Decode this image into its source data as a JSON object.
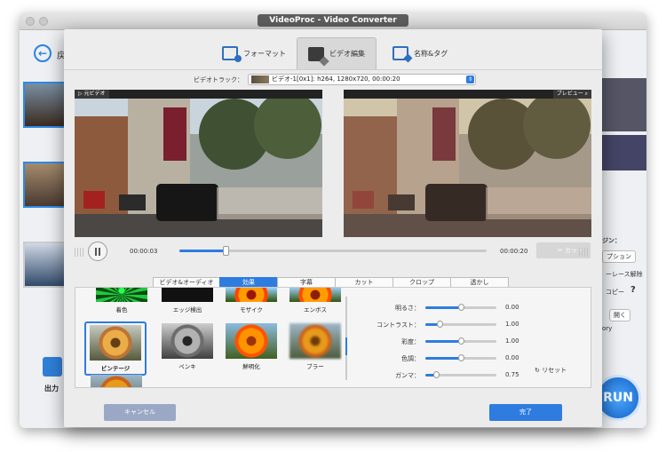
{
  "app": {
    "title": "VideoProc - Video Converter",
    "back_label": "戻",
    "output_label": "出力",
    "run_label": "RUN",
    "right_panel": {
      "heading": "ジン：",
      "option_button": "プション",
      "option_text": "ーレース解除",
      "copy_text": "コピー",
      "help_icon": "?",
      "open_button": "開く",
      "history_text": "ory"
    }
  },
  "dialog": {
    "tabs": [
      {
        "label": "フォーマット",
        "icon": "format-icon"
      },
      {
        "label": "ビデオ編集",
        "icon": "video-edit-icon"
      },
      {
        "label": "名称&タグ",
        "icon": "tag-icon"
      }
    ],
    "video_track": {
      "label": "ビデオトラック：",
      "value": "ビデオ-1[0x1]: h264, 1280x720, 00:00:20"
    },
    "original_label": "▷ 元ビデオ",
    "preview_label": "プレビュー ⌕",
    "playback": {
      "time_current": "00:00:03",
      "time_total": "00:00:20",
      "progress": 0.15,
      "cut_label": "カット"
    },
    "subtabs": [
      "ビデオ&オーディオ",
      "効果",
      "字幕",
      "カット",
      "クロップ",
      "透かし"
    ],
    "active_subtab": "効果",
    "effects": [
      {
        "label": "着色",
        "style": "green"
      },
      {
        "label": "エッジ検出",
        "style": "edge"
      },
      {
        "label": "モザイク",
        "style": "mosaic"
      },
      {
        "label": "エンボス",
        "style": "emboss"
      },
      {
        "label": "ビンテージ",
        "style": "vint",
        "selected": true
      },
      {
        "label": "ペンキ",
        "style": "pencil"
      },
      {
        "label": "鮮明化",
        "style": "vivid"
      },
      {
        "label": "ブラー",
        "style": "blur"
      }
    ],
    "adjustments": [
      {
        "name": "明るさ：",
        "value": "0.00",
        "level": 0.5
      },
      {
        "name": "コントラスト：",
        "value": "1.00",
        "level": 0.2
      },
      {
        "name": "彩度：",
        "value": "1.00",
        "level": 0.5
      },
      {
        "name": "色調：",
        "value": "0.00",
        "level": 0.5
      },
      {
        "name": "ガンマ：",
        "value": "0.75",
        "level": 0.15
      }
    ],
    "reset_label": "リセット",
    "cancel_label": "キャンセル",
    "ok_label": "完了"
  },
  "colors": {
    "accent": "#2e7ce0",
    "cancel": "#9aa8c6"
  }
}
